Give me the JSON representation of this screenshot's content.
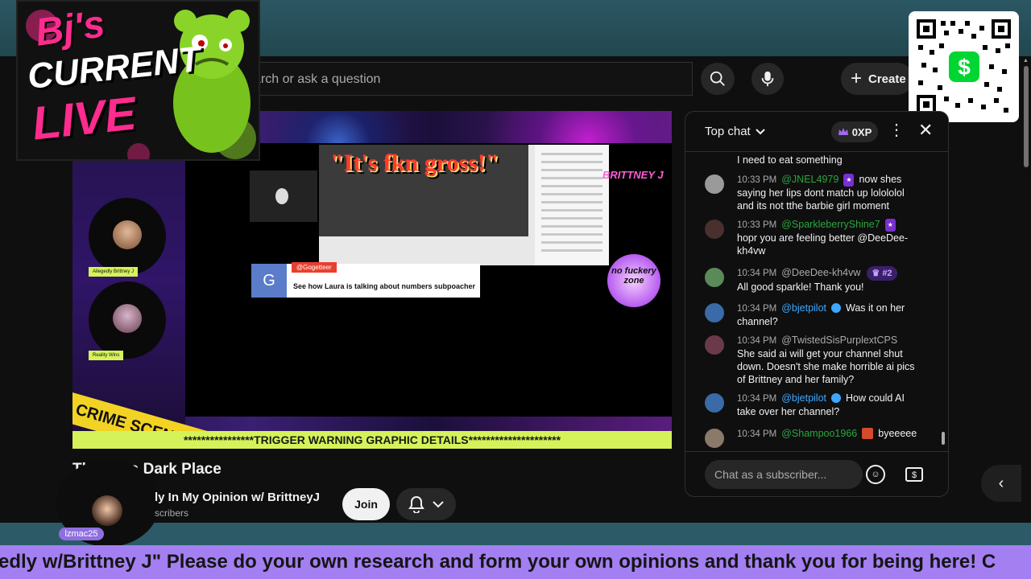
{
  "header": {
    "search_placeholder": "arch or ask a question",
    "create_label": "Create"
  },
  "logo": {
    "line1": "Bj's",
    "line2": "CURRENT",
    "line3": "LIVE"
  },
  "video": {
    "banner_text": "\"It's fkn gross!\"",
    "brittney_tag": "BRITTNEY J",
    "guest1_label": "Allegedly Brittney J",
    "guest2_label": "Reality Wins",
    "tape_text": "CRIME SCENE DO",
    "gbanner_name": "@Gogetteer",
    "gbanner_msg": "See how Laura is talking about numbers subpoacher",
    "gbanner_initial": "G",
    "nofuck_text": "no fuckery zone",
    "trigger_warning": "****************TRIGGER WARNING GRAPHIC DETAILS*********************"
  },
  "meta": {
    "title": "Th      ld is a Dark Place",
    "channel": "ly In My Opinion w/ BrittneyJ",
    "subscribers": "scribers",
    "join_label": "Join",
    "overlay_user": "lzmac25"
  },
  "chat": {
    "title": "Top chat",
    "xp": "0XP",
    "input_placeholder": "Chat as a subscriber...",
    "messages": [
      {
        "time": "",
        "author": "",
        "text": "I need to eat something"
      },
      {
        "time": "10:33 PM",
        "author": "@JNEL4979",
        "text": "now shes saying her lips dont match up lolololol and its not tthe barbie girl moment"
      },
      {
        "time": "10:33 PM",
        "author": "@SparkleberryShine7",
        "text": "hopr you are feeling better @DeeDee-kh4vw"
      },
      {
        "time": "10:34 PM",
        "author": "@DeeDee-kh4vw",
        "rank": "#2",
        "text": "All good sparkle! Thank you!"
      },
      {
        "time": "10:34 PM",
        "author": "@bjetpilot",
        "text": "Was it on her channel?"
      },
      {
        "time": "10:34 PM",
        "author": "@TwistedSisPurplextCPS",
        "text": "She said ai will get your channel shut down. Doesn't she make horrible ai pics of Brittney and her family?"
      },
      {
        "time": "10:34 PM",
        "author": "@bjetpilot",
        "text": "How could AI take over her channel?"
      },
      {
        "time": "10:34 PM",
        "author": "@Shampoo1966",
        "text": "byeeeee"
      }
    ]
  },
  "ticker": {
    "text": "edly w/Brittney J\" Please do your own research and form your own opinions and thank you for being here! C"
  },
  "colors": {
    "ticker_bg": "#a37ff2",
    "warning_bg": "#d5f25a",
    "chat_author_green": "#2ba640",
    "chat_author_blue": "#3ea6ff"
  }
}
